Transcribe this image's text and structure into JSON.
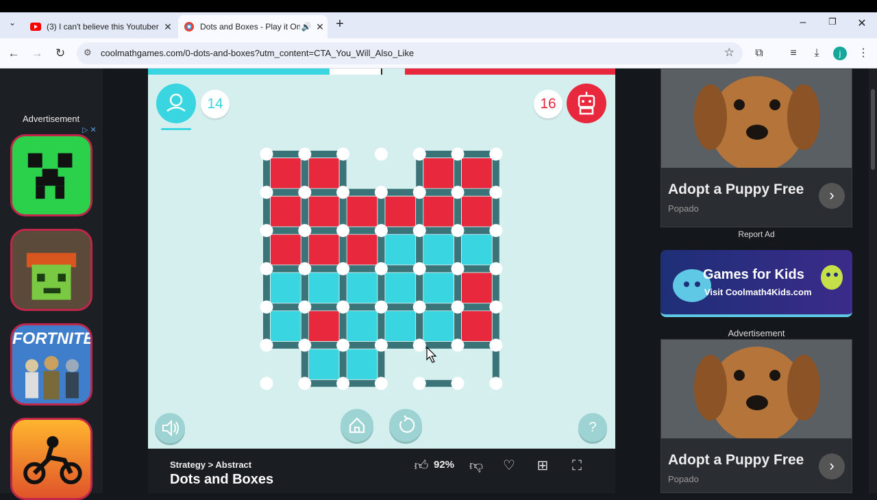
{
  "browser": {
    "tabs": [
      {
        "title": "(3) I can't believe this Youtuber",
        "active": false
      },
      {
        "title": "Dots and Boxes - Play it Onl",
        "active": true
      }
    ],
    "url": "coolmathgames.com/0-dots-and-boxes?utm_content=CTA_You_Will_Also_Like",
    "profile_initial": "j"
  },
  "left_ad": {
    "label": "Advertisement",
    "thumbs": [
      {
        "name": "minecraft-thumb",
        "text": ""
      },
      {
        "name": "melon-thumb",
        "text": ""
      },
      {
        "name": "fortnite-thumb",
        "text": "FORTNITE"
      },
      {
        "name": "moto-thumb",
        "text": ""
      }
    ]
  },
  "game": {
    "player_score": "14",
    "robot_score": "16",
    "progress": {
      "player_fraction": 0.43,
      "robot_fraction": 0.45
    },
    "colors": {
      "player": "#39d5e0",
      "robot": "#e8283c",
      "board_line": "#3a7378",
      "bg": "#d5efef"
    }
  },
  "info": {
    "category": "Strategy",
    "subcategory": "Abstract",
    "separator": " > ",
    "title": "Dots and Boxes",
    "like_percent": "92%"
  },
  "right_ad": {
    "card1": {
      "headline": "Adopt a Puppy Free",
      "source": "Popado"
    },
    "report": "Report Ad",
    "banner": {
      "title": "Games for Kids",
      "sub": "Visit Coolmath4Kids.com"
    },
    "label2": "Advertisement",
    "card2": {
      "headline": "Adopt a Puppy Free",
      "source": "Popado"
    }
  }
}
